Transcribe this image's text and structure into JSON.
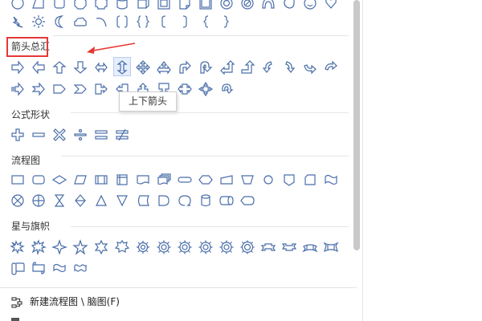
{
  "panel": {
    "sections": {
      "arrows": {
        "title": "箭头总汇"
      },
      "formula": {
        "title": "公式形状"
      },
      "flowchart": {
        "title": "流程图"
      },
      "stars": {
        "title": "星与旗帜"
      }
    },
    "tooltip": "上下箭头",
    "new_flowchart_item": "新建流程图 \\ 脑图(F)",
    "accent_color": "#4a6ea9",
    "annotation_color": "#e53935"
  }
}
